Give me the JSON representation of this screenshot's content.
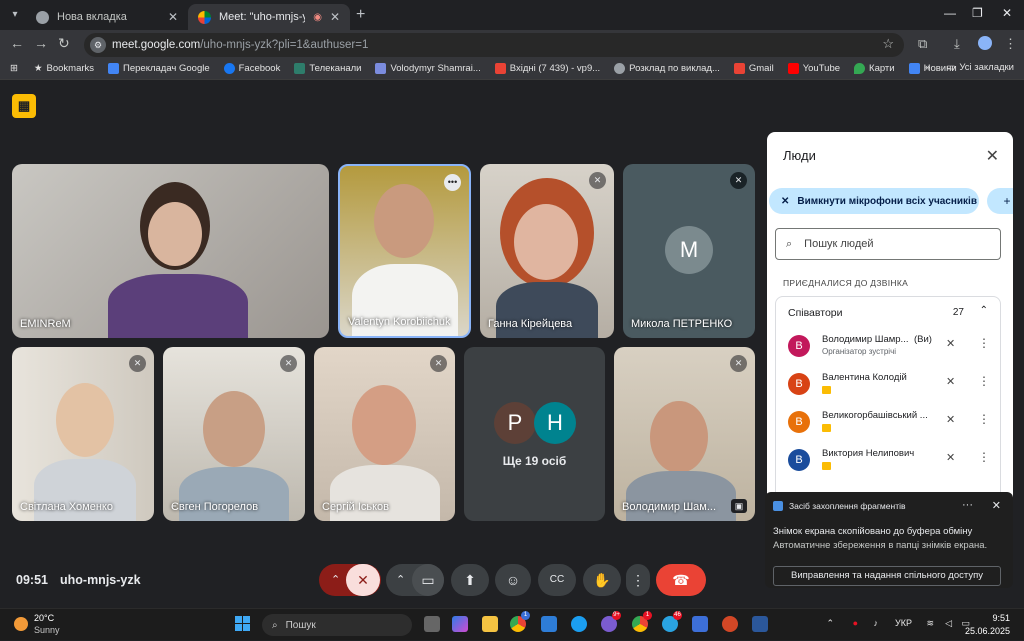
{
  "browser": {
    "tabs": [
      {
        "title": "Нова вкладка"
      },
      {
        "title": "Meet: \"uho-mnjs-yzk\""
      }
    ],
    "url_host": "meet.google.com",
    "url_path": "/uho-mnjs-yzk?pli=1&authuser=1",
    "bookmarks": [
      "Bookmarks",
      "Перекладач Google",
      "Facebook",
      "Телеканали",
      "Volodymyr Shamrai...",
      "Вхідні (7 439) - vp9...",
      "Розклад по виклад...",
      "Gmail",
      "YouTube",
      "Карти",
      "Новини"
    ],
    "all_bookmarks": "Усі закладки"
  },
  "meeting": {
    "time": "09:51",
    "code": "uho-mnjs-yzk",
    "tiles": [
      {
        "name": "EMINReM"
      },
      {
        "name": "Valentyn Korobiichuk"
      },
      {
        "name": "Ганна Кірейцева"
      },
      {
        "name": "Микола ПЕТРЕНКО",
        "avatar": "M"
      },
      {
        "name": "Світлана Хоменко"
      },
      {
        "name": "Євген Погорелов"
      },
      {
        "name": "Сергій Іськов"
      },
      {
        "name": "Володимир Шам..."
      }
    ],
    "more": {
      "label": "Ще 19 осіб",
      "avatars": [
        "P",
        "H"
      ]
    },
    "colors": {
      "hangup": "#ea4335",
      "mic_off_bg": "#f9dedc",
      "more_p": "#5d4037",
      "more_h": "#00838f"
    }
  },
  "people_panel": {
    "title": "Люди",
    "mute_all": "Вимкнути мікрофони всіх учасників",
    "search_placeholder": "Пошук людей",
    "section": "ПРИЄДНАЛИСЯ ДО ДЗВІНКА",
    "group": "Співавтори",
    "count": "27",
    "people": [
      {
        "avatar": "В",
        "name": "Володимир Шамр...",
        "you": "(Ви)",
        "sub": "Організатор зустрічі",
        "color": "#c2185b"
      },
      {
        "avatar": "В",
        "name": "Валентина Колодій",
        "color": "#d84315"
      },
      {
        "avatar": "В",
        "name": "Великогорбашівський ...",
        "color": "#e8710a"
      },
      {
        "avatar": "В",
        "name": "Виктория Нелипович",
        "color": "#1a4c9c"
      }
    ]
  },
  "toast": {
    "title": "Засіб захоплення фрагментів",
    "message": "Знімок екрана скопійовано до буфера обміну",
    "detail": "Автоматичне збереження в папці знімків екрана.",
    "button": "Виправлення та надання спільного доступу"
  },
  "taskbar": {
    "temp": "20°C",
    "condition": "Sunny",
    "search": "Пошук",
    "lang": "УКР",
    "time": "9:51",
    "date": "25.06.2025",
    "badges": [
      "1",
      "9+",
      "1",
      "46"
    ]
  }
}
